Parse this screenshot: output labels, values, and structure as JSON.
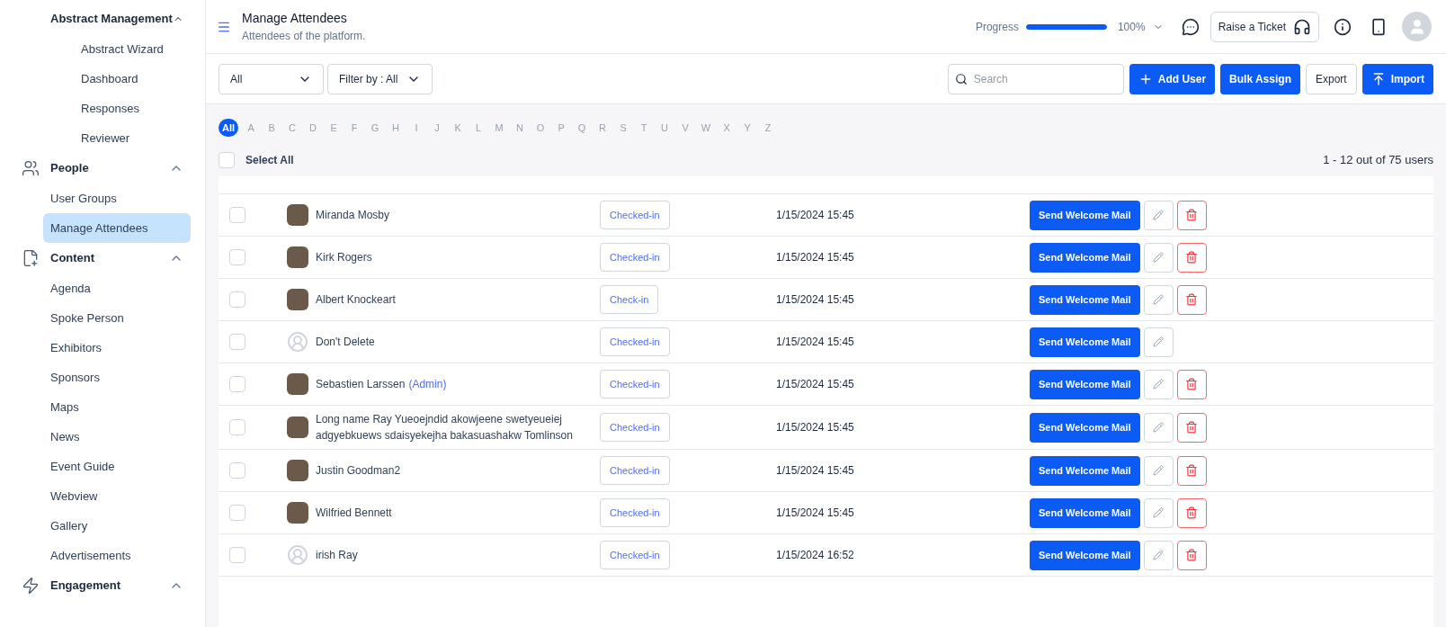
{
  "sidebar": {
    "sections": [
      {
        "label": "Abstract Management",
        "kind": "group",
        "expanded": true,
        "children": [
          {
            "label": "Abstract Wizard",
            "selected": false
          },
          {
            "label": "Dashboard",
            "selected": false
          },
          {
            "label": "Responses",
            "selected": false
          },
          {
            "label": "Reviewer",
            "selected": false
          }
        ]
      },
      {
        "label": "People",
        "kind": "people",
        "expanded": true,
        "children": [
          {
            "label": "User Groups",
            "selected": false
          },
          {
            "label": "Manage Attendees",
            "selected": true
          }
        ]
      },
      {
        "label": "Content",
        "kind": "content",
        "expanded": true,
        "children": [
          {
            "label": "Agenda",
            "selected": false
          },
          {
            "label": "Spoke Person",
            "selected": false
          },
          {
            "label": "Exhibitors",
            "selected": false
          },
          {
            "label": "Sponsors",
            "selected": false
          },
          {
            "label": "Maps",
            "selected": false
          },
          {
            "label": "News",
            "selected": false
          },
          {
            "label": "Event Guide",
            "selected": false
          },
          {
            "label": "Webview",
            "selected": false
          },
          {
            "label": "Gallery",
            "selected": false
          },
          {
            "label": "Advertisements",
            "selected": false
          }
        ]
      },
      {
        "label": "Engagement",
        "kind": "engagement",
        "expanded": true
      }
    ]
  },
  "header": {
    "title": "Manage Attendees",
    "subtitle": "Attendees of the platform.",
    "progress_label": "Progress",
    "progress": {
      "level": 1
    },
    "progress_reading": "100%",
    "ticket_button": "Raise a Ticket"
  },
  "toolbar": {
    "filters": [
      "All",
      "Filter by : All"
    ],
    "search": {
      "placeholder": "Search"
    },
    "buttons": [
      {
        "label": "Add User",
        "kind": "add"
      },
      {
        "label": "Bulk Assign",
        "kind": "primary"
      },
      {
        "label": "Export",
        "kind": "outline"
      },
      {
        "label": "Import",
        "kind": "import"
      }
    ]
  },
  "alphabet": [
    {
      "label": "All",
      "selected": true
    },
    {
      "label": "A",
      "selected": false
    },
    {
      "label": "B",
      "selected": false
    },
    {
      "label": "C",
      "selected": false
    },
    {
      "label": "D",
      "selected": false
    },
    {
      "label": "E",
      "selected": false
    },
    {
      "label": "F",
      "selected": false
    },
    {
      "label": "G",
      "selected": false
    },
    {
      "label": "H",
      "selected": false
    },
    {
      "label": "I",
      "selected": false
    },
    {
      "label": "J",
      "selected": false
    },
    {
      "label": "K",
      "selected": false
    },
    {
      "label": "L",
      "selected": false
    },
    {
      "label": "M",
      "selected": false
    },
    {
      "label": "N",
      "selected": false
    },
    {
      "label": "O",
      "selected": false
    },
    {
      "label": "P",
      "selected": false
    },
    {
      "label": "Q",
      "selected": false
    },
    {
      "label": "R",
      "selected": false
    },
    {
      "label": "S",
      "selected": false
    },
    {
      "label": "T",
      "selected": false
    },
    {
      "label": "U",
      "selected": false
    },
    {
      "label": "V",
      "selected": false
    },
    {
      "label": "W",
      "selected": false
    },
    {
      "label": "X",
      "selected": false
    },
    {
      "label": "Y",
      "selected": false
    },
    {
      "label": "Z",
      "selected": false
    }
  ],
  "select_all": {
    "label": "Select All",
    "checked": false
  },
  "count": "1 - 12 out of 75 users",
  "rows": [
    {
      "name": "Miranda Mosby",
      "kind": "photo",
      "checked": false,
      "status": "Checked-in",
      "date": "1/15/2024 15:45",
      "mail": "Send Welcome Mail",
      "deletable": true
    },
    {
      "name": "Kirk Rogers",
      "kind": "photo",
      "checked": false,
      "status": "Checked-in",
      "date": "1/15/2024 15:45",
      "mail": "Send Welcome Mail",
      "deletable": true
    },
    {
      "name": "Albert Knockeart",
      "kind": "photo",
      "checked": false,
      "status": "Check-in",
      "date": "1/15/2024 15:45",
      "mail": "Send Welcome Mail",
      "deletable": true
    },
    {
      "name": "Don't Delete",
      "kind": "default",
      "checked": false,
      "status": "Checked-in",
      "date": "1/15/2024 15:45",
      "mail": "Send Welcome Mail",
      "deletable": false
    },
    {
      "name": "Sebastien Larssen",
      "admin": "(Admin)",
      "kind": "photo",
      "checked": false,
      "status": "Checked-in",
      "date": "1/15/2024 15:45",
      "mail": "Send Welcome Mail",
      "deletable": true
    },
    {
      "name": "Long name Ray Yueoejndid akowjeene swetyeueiej adgyebkuews sdaisyekejha bakasuashakw Tomlinson",
      "kind": "photo",
      "checked": false,
      "status": "Checked-in",
      "date": "1/15/2024 15:45",
      "mail": "Send Welcome Mail",
      "deletable": true
    },
    {
      "name": "Justin Goodman2",
      "kind": "photo",
      "checked": false,
      "status": "Checked-in",
      "date": "1/15/2024 15:45",
      "mail": "Send Welcome Mail",
      "deletable": true
    },
    {
      "name": "Wilfried Bennett",
      "kind": "photo",
      "checked": false,
      "status": "Checked-in",
      "date": "1/15/2024 15:45",
      "mail": "Send Welcome Mail",
      "deletable": true
    },
    {
      "name": "irish Ray",
      "kind": "default",
      "checked": false,
      "status": "Checked-in",
      "date": "1/15/2024 16:52",
      "mail": "Send Welcome Mail",
      "deletable": true
    }
  ]
}
